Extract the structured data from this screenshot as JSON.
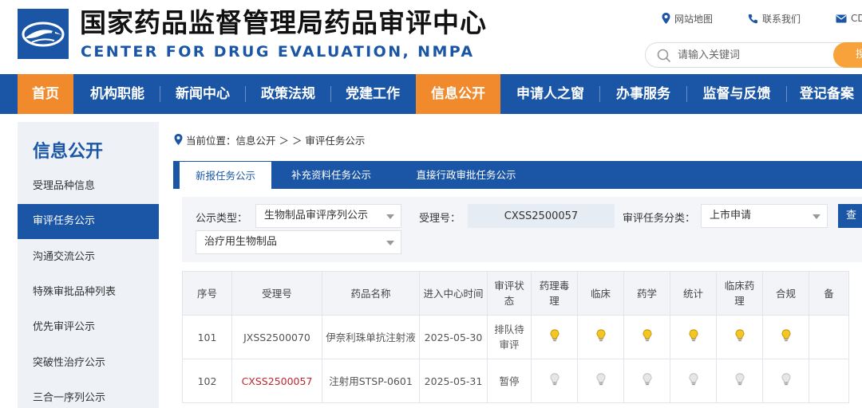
{
  "header": {
    "title": "国家药品监督管理局药品审评中心",
    "subtitle": "CENTER FOR DRUG EVALUATION, NMPA",
    "top_links": [
      {
        "label": "网站地图",
        "icon": "location-pin-icon"
      },
      {
        "label": "联系我们",
        "icon": "phone-icon"
      },
      {
        "label": "CD",
        "icon": "mail-icon"
      }
    ],
    "search": {
      "placeholder": "请输入关键词",
      "button_label": "搜"
    }
  },
  "nav": {
    "items": [
      {
        "label": "首页",
        "active": true
      },
      {
        "label": "机构职能"
      },
      {
        "label": "新闻中心"
      },
      {
        "label": "政策法规"
      },
      {
        "label": "党建工作"
      },
      {
        "label": "信息公开",
        "active": true
      },
      {
        "label": "申请人之窗"
      },
      {
        "label": "办事服务"
      },
      {
        "label": "监督与反馈"
      },
      {
        "label": "登记备案"
      }
    ]
  },
  "sidebar": {
    "title": "信息公开",
    "items": [
      {
        "label": "受理品种信息"
      },
      {
        "label": "审评任务公示",
        "active": true
      },
      {
        "label": "沟通交流公示"
      },
      {
        "label": "特殊审批品种列表"
      },
      {
        "label": "优先审评公示"
      },
      {
        "label": "突破性治疗公示"
      },
      {
        "label": "三合一序列公示"
      }
    ]
  },
  "breadcrumb": {
    "text": "当前位置：信息公开 ＞ ＞ 审评任务公示"
  },
  "tabs": [
    {
      "label": "新报任务公示",
      "active": true
    },
    {
      "label": "补充资料任务公示"
    },
    {
      "label": "直接行政审批任务公示"
    }
  ],
  "filters": {
    "type_label": "公示类型：",
    "type_value": "生物制品审评序列公示",
    "accept_no_label": "受理号：",
    "accept_no_value": "CXSS2500057",
    "category_label": "审评任务分类：",
    "category_value": "上市申请",
    "subtype_value": "治疗用生物制品",
    "query_button": "查"
  },
  "table": {
    "columns": [
      "序号",
      "受理号",
      "药品名称",
      "进入中心时间",
      "审评状态",
      "药理毒理",
      "临床",
      "药学",
      "统计",
      "临床药理",
      "合规",
      "备"
    ],
    "rows": [
      {
        "no": "101",
        "accept_no": "JXSS2500070",
        "name": "伊奈利珠单抗注射液",
        "date": "2025-05-30",
        "status": "排队待审评",
        "lit": true
      },
      {
        "no": "102",
        "accept_no": "CXSS2500057",
        "name": "注射用STSP-0601",
        "date": "2025-05-31",
        "status": "暂停",
        "lit": false,
        "highlight": true
      }
    ],
    "bulb_colors": {
      "lit": "#f3c623",
      "unlit": "#e6e6e6"
    }
  },
  "colors": {
    "brand_blue": "#1b56a6",
    "accent_orange": "#f08a2c",
    "highlight_red": "#c0282d"
  }
}
